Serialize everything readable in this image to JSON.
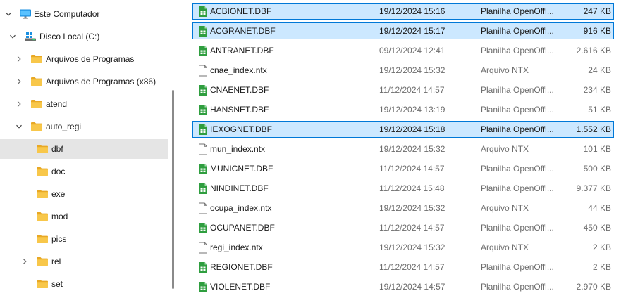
{
  "navigation": {
    "items": [
      {
        "label": "Este Computador",
        "icon": "computer-icon",
        "expanded": true
      },
      {
        "label": "Disco Local (C:)",
        "icon": "drive-icon",
        "expanded": true
      },
      {
        "label": "Arquivos de Programas",
        "icon": "folder-icon",
        "expanded": false
      },
      {
        "label": "Arquivos de Programas (x86)",
        "icon": "folder-icon",
        "expanded": false
      },
      {
        "label": "atend",
        "icon": "folder-icon",
        "expanded": false
      },
      {
        "label": "auto_regi",
        "icon": "folder-icon",
        "expanded": true
      },
      {
        "label": "dbf",
        "icon": "folder-icon",
        "selected": true
      },
      {
        "label": "doc",
        "icon": "folder-icon"
      },
      {
        "label": "exe",
        "icon": "folder-icon"
      },
      {
        "label": "mod",
        "icon": "folder-icon"
      },
      {
        "label": "pics",
        "icon": "folder-icon"
      },
      {
        "label": "rel",
        "icon": "folder-icon",
        "expanded": false
      },
      {
        "label": "set",
        "icon": "folder-icon"
      }
    ]
  },
  "files": [
    {
      "name": "ACBIONET.DBF",
      "date": "19/12/2024 15:16",
      "type": "Planilha OpenOffi...",
      "size": "247 KB",
      "icon": "spreadsheet-icon",
      "selected": true
    },
    {
      "name": "ACGRANET.DBF",
      "date": "19/12/2024 15:17",
      "type": "Planilha OpenOffi...",
      "size": "916 KB",
      "icon": "spreadsheet-icon",
      "selected": true
    },
    {
      "name": "ANTRANET.DBF",
      "date": "09/12/2024 12:41",
      "type": "Planilha OpenOffi...",
      "size": "2.616 KB",
      "icon": "spreadsheet-icon"
    },
    {
      "name": "cnae_index.ntx",
      "date": "19/12/2024 15:32",
      "type": "Arquivo NTX",
      "size": "24 KB",
      "icon": "file-icon"
    },
    {
      "name": "CNAENET.DBF",
      "date": "11/12/2024 14:57",
      "type": "Planilha OpenOffi...",
      "size": "234 KB",
      "icon": "spreadsheet-icon"
    },
    {
      "name": "HANSNET.DBF",
      "date": "19/12/2024 13:19",
      "type": "Planilha OpenOffi...",
      "size": "51 KB",
      "icon": "spreadsheet-icon"
    },
    {
      "name": "IEXOGNET.DBF",
      "date": "19/12/2024 15:18",
      "type": "Planilha OpenOffi...",
      "size": "1.552 KB",
      "icon": "spreadsheet-icon",
      "selected": true
    },
    {
      "name": "mun_index.ntx",
      "date": "19/12/2024 15:32",
      "type": "Arquivo NTX",
      "size": "101 KB",
      "icon": "file-icon"
    },
    {
      "name": "MUNICNET.DBF",
      "date": "11/12/2024 14:57",
      "type": "Planilha OpenOffi...",
      "size": "500 KB",
      "icon": "spreadsheet-icon"
    },
    {
      "name": "NINDINET.DBF",
      "date": "11/12/2024 15:48",
      "type": "Planilha OpenOffi...",
      "size": "9.377 KB",
      "icon": "spreadsheet-icon"
    },
    {
      "name": "ocupa_index.ntx",
      "date": "19/12/2024 15:32",
      "type": "Arquivo NTX",
      "size": "44 KB",
      "icon": "file-icon"
    },
    {
      "name": "OCUPANET.DBF",
      "date": "11/12/2024 14:57",
      "type": "Planilha OpenOffi...",
      "size": "450 KB",
      "icon": "spreadsheet-icon"
    },
    {
      "name": "regi_index.ntx",
      "date": "19/12/2024 15:32",
      "type": "Arquivo NTX",
      "size": "2 KB",
      "icon": "file-icon"
    },
    {
      "name": "REGIONET.DBF",
      "date": "11/12/2024 14:57",
      "type": "Planilha OpenOffi...",
      "size": "2 KB",
      "icon": "spreadsheet-icon"
    },
    {
      "name": "VIOLENET.DBF",
      "date": "19/12/2024 14:57",
      "type": "Planilha OpenOffi...",
      "size": "2.970 KB",
      "icon": "spreadsheet-icon"
    }
  ],
  "colors": {
    "selection_bg": "#cce8ff",
    "selection_border": "#0078d7",
    "folder": "#f8c74a",
    "spreadsheet": "#2f9e3f"
  }
}
